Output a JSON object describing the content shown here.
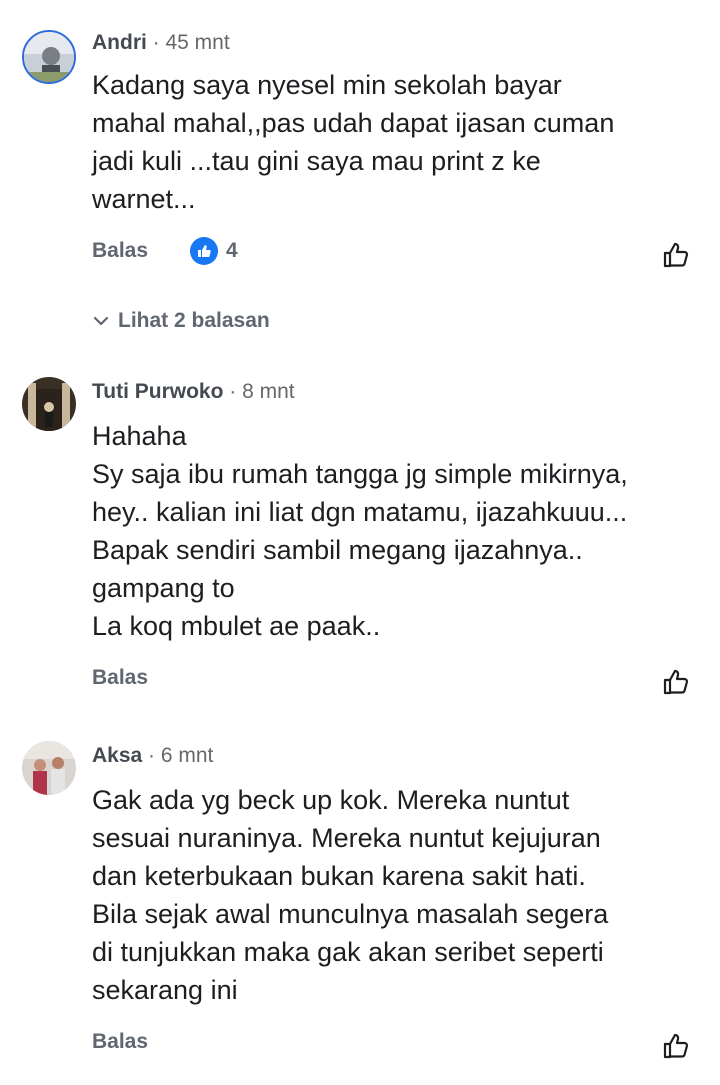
{
  "comments": [
    {
      "author": "Andri",
      "time": " · 45 mnt",
      "lines": [
        "Kadang saya nyesel min sekolah bayar",
        "mahal mahal,,pas udah dapat ijasan cuman",
        "jadi kuli ...tau gini saya mau print z ke",
        "warnet..."
      ],
      "reply_label": "Balas",
      "reaction_count": "4",
      "view_replies": "Lihat 2 balasan"
    },
    {
      "author": "Tuti Purwoko",
      "time": " · 8 mnt",
      "lines": [
        "Hahaha",
        "Sy saja ibu rumah tangga jg simple mikirnya,",
        "hey.. kalian ini liat dgn matamu, ijazahkuuu...",
        "Bapak sendiri sambil megang ijazahnya..",
        "gampang to",
        "La koq mbulet ae paak.."
      ],
      "reply_label": "Balas"
    },
    {
      "author": "Aksa",
      "time": " · 6 mnt",
      "lines": [
        "Gak ada yg beck up kok. Mereka nuntut",
        "sesuai nuraninya. Mereka nuntut kejujuran",
        "dan keterbukaan bukan karena sakit hati.",
        "Bila sejak awal munculnya masalah segera",
        "di tunjukkan maka gak akan seribet seperti",
        "sekarang ini"
      ],
      "reply_label": "Balas"
    }
  ],
  "icons": {
    "like": "thumbs-up-outline-icon",
    "reaction": "like-reaction-icon",
    "chevron": "chevron-down-icon"
  },
  "colors": {
    "reaction_blue": "#1877f2",
    "meta_gray": "#65676b"
  }
}
